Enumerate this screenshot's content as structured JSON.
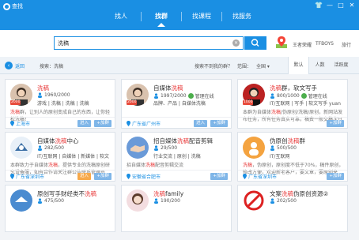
{
  "window": {
    "title": "查找",
    "controls": [
      "menu",
      "minimize",
      "maximize",
      "close"
    ]
  },
  "tabs": [
    "找人",
    "找群",
    "找课程",
    "找服务"
  ],
  "active_tab": "找群",
  "search": {
    "value": "洗稿",
    "placeholder": "",
    "button": "search"
  },
  "hot_tags": [
    "王者荣耀",
    "TFBOYS",
    "旅行"
  ],
  "filter": {
    "back": "返回",
    "query_label": "搜索：洗稿",
    "not_found": "搜索不到我的群？",
    "scope_label": "范围：",
    "scope_value": "全国",
    "sort_tabs": [
      "默认",
      "人数",
      "活跃度"
    ],
    "active_sort": "默认"
  },
  "colors": {
    "accent": "#1a8fe3",
    "highlight": "#e83a3a",
    "join": "#7fb6e8",
    "joined": "#f7a94b"
  },
  "cards": [
    {
      "name_pre": "",
      "name_hl": "洗稿",
      "name_post": "",
      "badge": "",
      "members": "1960/2000",
      "certified": false,
      "tags": "游戏 | 洗稿 | 洗稿 | 洗稿",
      "desc_pre": "",
      "desc_hl": "洗稿",
      "desc_post": "群，让别人的原创变成自己的东西，让你轻松洗稿！",
      "location": "上海市",
      "btn1": "进入",
      "btn1_style": "blue",
      "btn2": "+加群",
      "avatar": "person",
      "level": "2000"
    },
    {
      "name_pre": "自媒体",
      "name_hl": "洗稿",
      "name_post": "",
      "badge": "",
      "members": "1997/2000",
      "certified": true,
      "cert_label": "管理在线",
      "tags": "品牌、产品 | 自媒体洗稿",
      "desc_pre": "",
      "desc_hl": "",
      "desc_post": "",
      "location": "广东省广州市",
      "btn1": "进入",
      "btn1_style": "blue",
      "btn2": "+加群",
      "avatar": "person",
      "level": "2000"
    },
    {
      "name_pre": "",
      "name_hl": "洗稿",
      "name_post": "群，软文写手",
      "badge": "",
      "members": "800/1000",
      "certified": true,
      "cert_label": "管理在线",
      "tags": "IT/互联网 | 写手 | 软文写手 yuan",
      "desc_pre": "本群为自媒体",
      "desc_hl": "洗稿",
      "desc_post": "/伪原创/洗稿/原创，新网站发布任务，所有任务真实可靠，稿费一般交稿次日结算",
      "location": "",
      "btn1": "",
      "btn1_style": "blue",
      "btn2": "+加群",
      "avatar": "person-red",
      "level": "1000"
    },
    {
      "name_pre": "自媒体",
      "name_hl": "洗稿",
      "name_post": "中心",
      "badge": "",
      "members": "282/500",
      "certified": false,
      "tags": "IT/互联网 | 自媒体 | 新媒体 | 软文",
      "desc_pre": "本群致力于自媒体",
      "desc_hl": "洗稿",
      "desc_post": "，提供专业的洗稿原创研究设备服，如有合作请关注群公告联系管理员",
      "location": "广东省深圳市",
      "btn1": "进入",
      "btn1_style": "orange",
      "btn2": "+加群",
      "avatar": "bird",
      "level": ""
    },
    {
      "name_pre": "招自媒体",
      "name_hl": "洗稿",
      "name_post": "配音剪辑",
      "badge": "",
      "members": "29/500",
      "certified": false,
      "tags": "行业交流 | 原创 | 洗稿",
      "desc_pre": "招自媒体",
      "desc_hl": "洗稿",
      "desc_post": "配音剪辑交流",
      "location": "安徽省合肥市",
      "btn1": "",
      "btn1_style": "blue",
      "btn2": "+加群",
      "avatar": "handshake",
      "level": ""
    },
    {
      "name_pre": "伪原创",
      "name_hl": "洗稿",
      "name_post": "群",
      "badge": "",
      "members": "500/500",
      "certified": false,
      "tags": "IT/互联网",
      "desc_pre": "",
      "desc_hl": "洗稿",
      "desc_post": "，伪原创，原创度不低于70%，稿件原创，修改方便，欢迎新老客户，要文章，要原创来",
      "location": "广东省深圳市",
      "btn1": "",
      "btn1_style": "blue",
      "btn2": "+加群",
      "avatar": "person-orange",
      "level": ""
    },
    {
      "name_pre": "原创写手财经类不",
      "name_hl": "洗稿",
      "name_post": "",
      "badge": "",
      "members": "475/500",
      "certified": false,
      "tags": "",
      "desc_pre": "",
      "desc_hl": "",
      "desc_post": "",
      "location": "",
      "btn1": "",
      "btn1_style": "blue",
      "btn2": "",
      "avatar": "bird-blue",
      "level": ""
    },
    {
      "name_pre": "",
      "name_hl": "洗稿",
      "name_post": "family",
      "badge": "",
      "members": "190/200",
      "certified": false,
      "tags": "",
      "desc_pre": "",
      "desc_hl": "",
      "desc_post": "",
      "location": "",
      "btn1": "",
      "btn1_style": "blue",
      "btn2": "",
      "avatar": "girl",
      "level": ""
    },
    {
      "name_pre": "文案",
      "name_hl": "洗稿",
      "name_post": "伪原创资源②",
      "badge": "",
      "members": "202/500",
      "certified": false,
      "tags": "",
      "desc_pre": "",
      "desc_hl": "",
      "desc_post": "",
      "location": "",
      "btn1": "",
      "btn1_style": "blue",
      "btn2": "",
      "avatar": "stop",
      "level": ""
    }
  ]
}
